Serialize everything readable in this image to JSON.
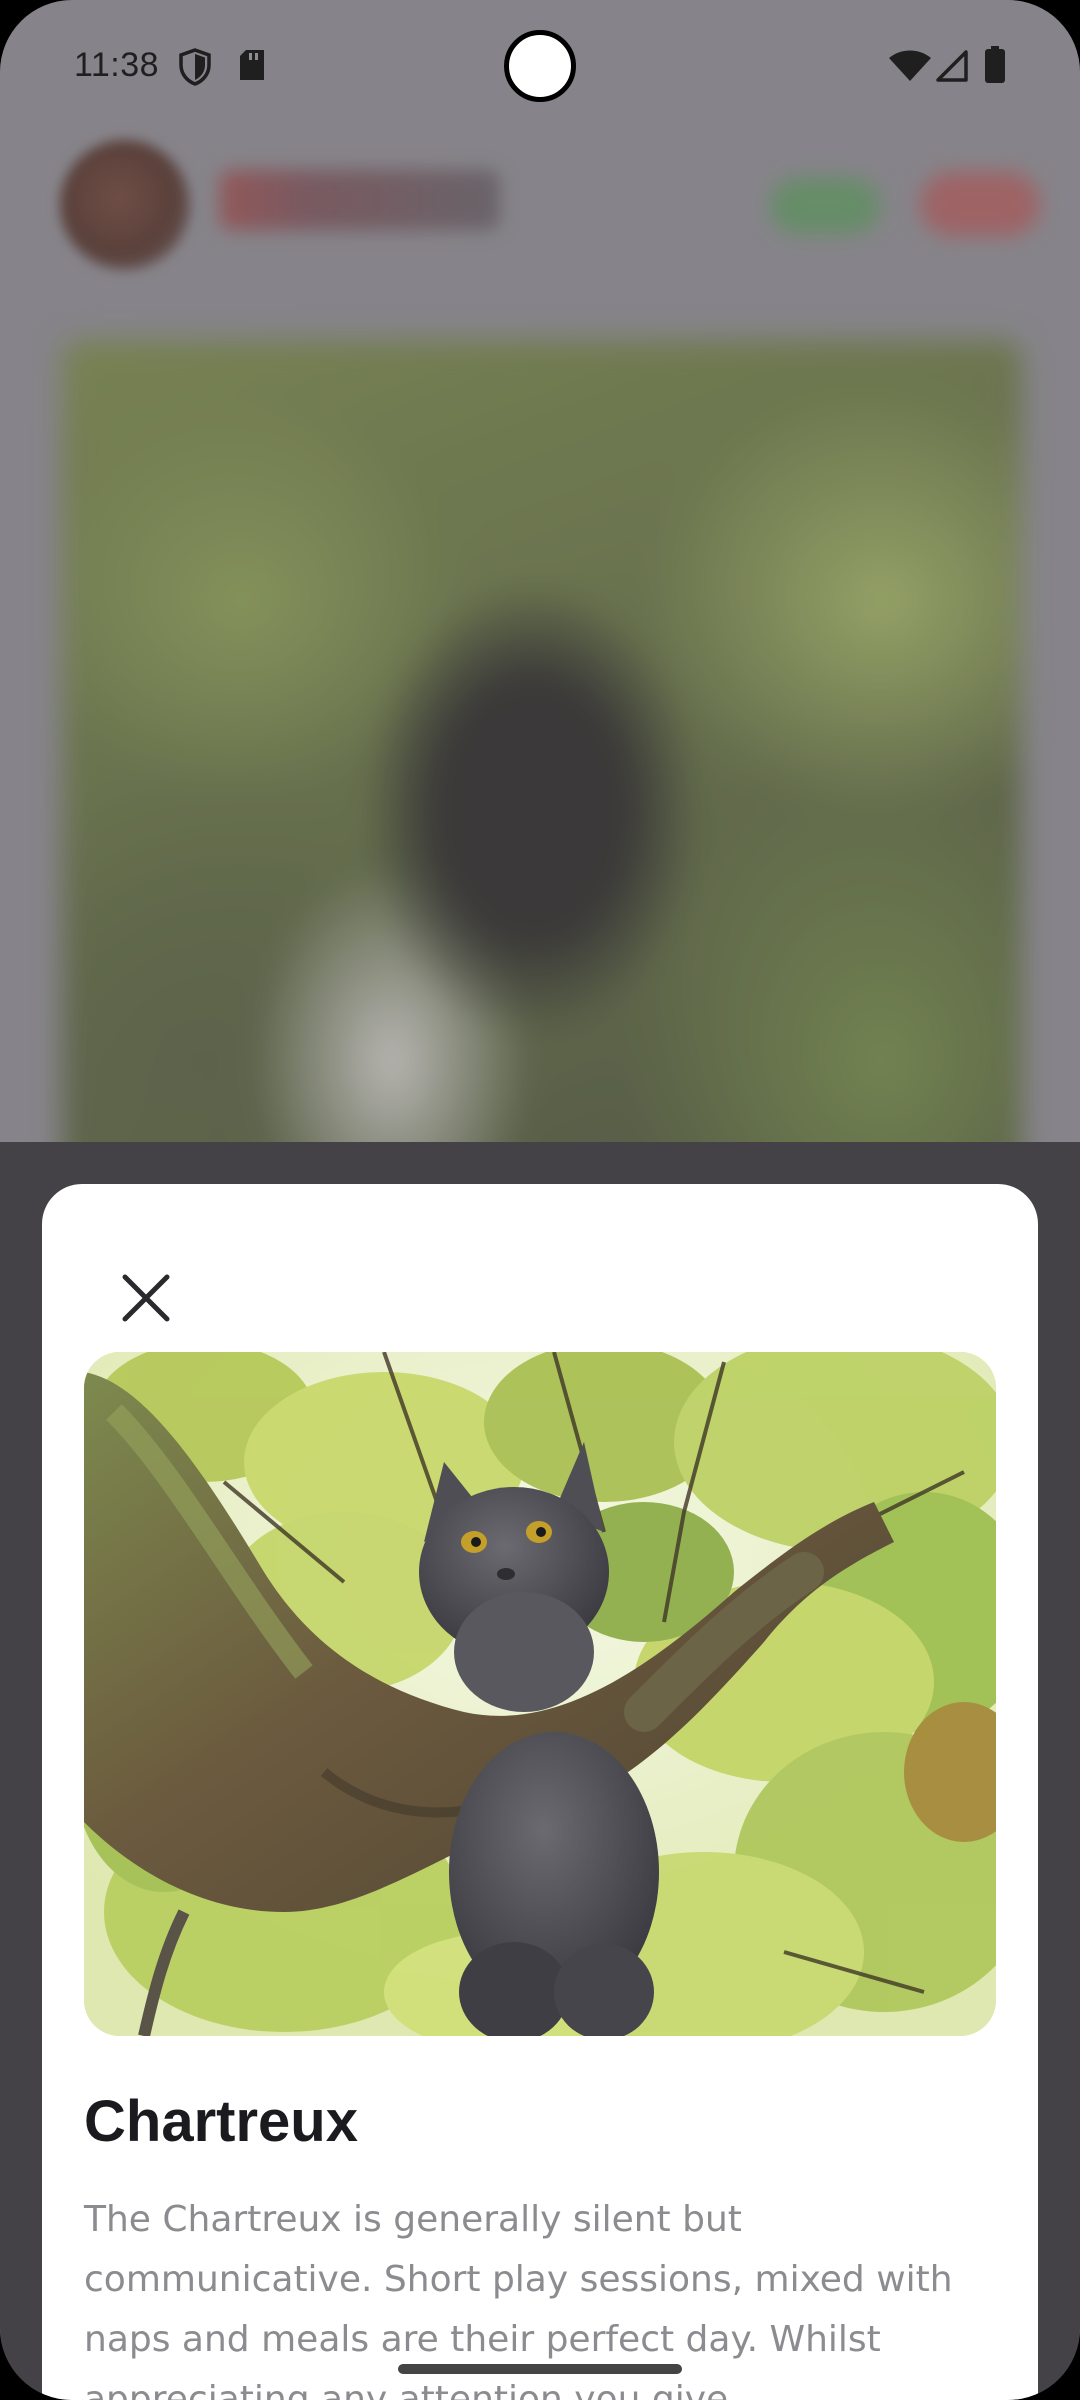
{
  "status_bar": {
    "time": "11:38",
    "left_icons": [
      "shield-icon",
      "sd-card-icon"
    ],
    "right_icons": [
      "wifi-icon",
      "signal-icon",
      "battery-icon"
    ]
  },
  "background_app": {
    "blurred": true,
    "header_buttons": [
      "green-action",
      "red-action"
    ]
  },
  "dialog": {
    "close_icon": "close-icon",
    "photo_subject": "cat-photo",
    "breed_name": "Chartreux",
    "description": "The Chartreux is generally silent but communicative. Short play sessions, mixed with naps and meals are their perfect day. Whilst appreciating any attention you give"
  },
  "colors": {
    "scrim": "#444246",
    "dialog_bg": "#ffffff",
    "title": "#1b1b1f",
    "body_text": "#8c8c90"
  }
}
